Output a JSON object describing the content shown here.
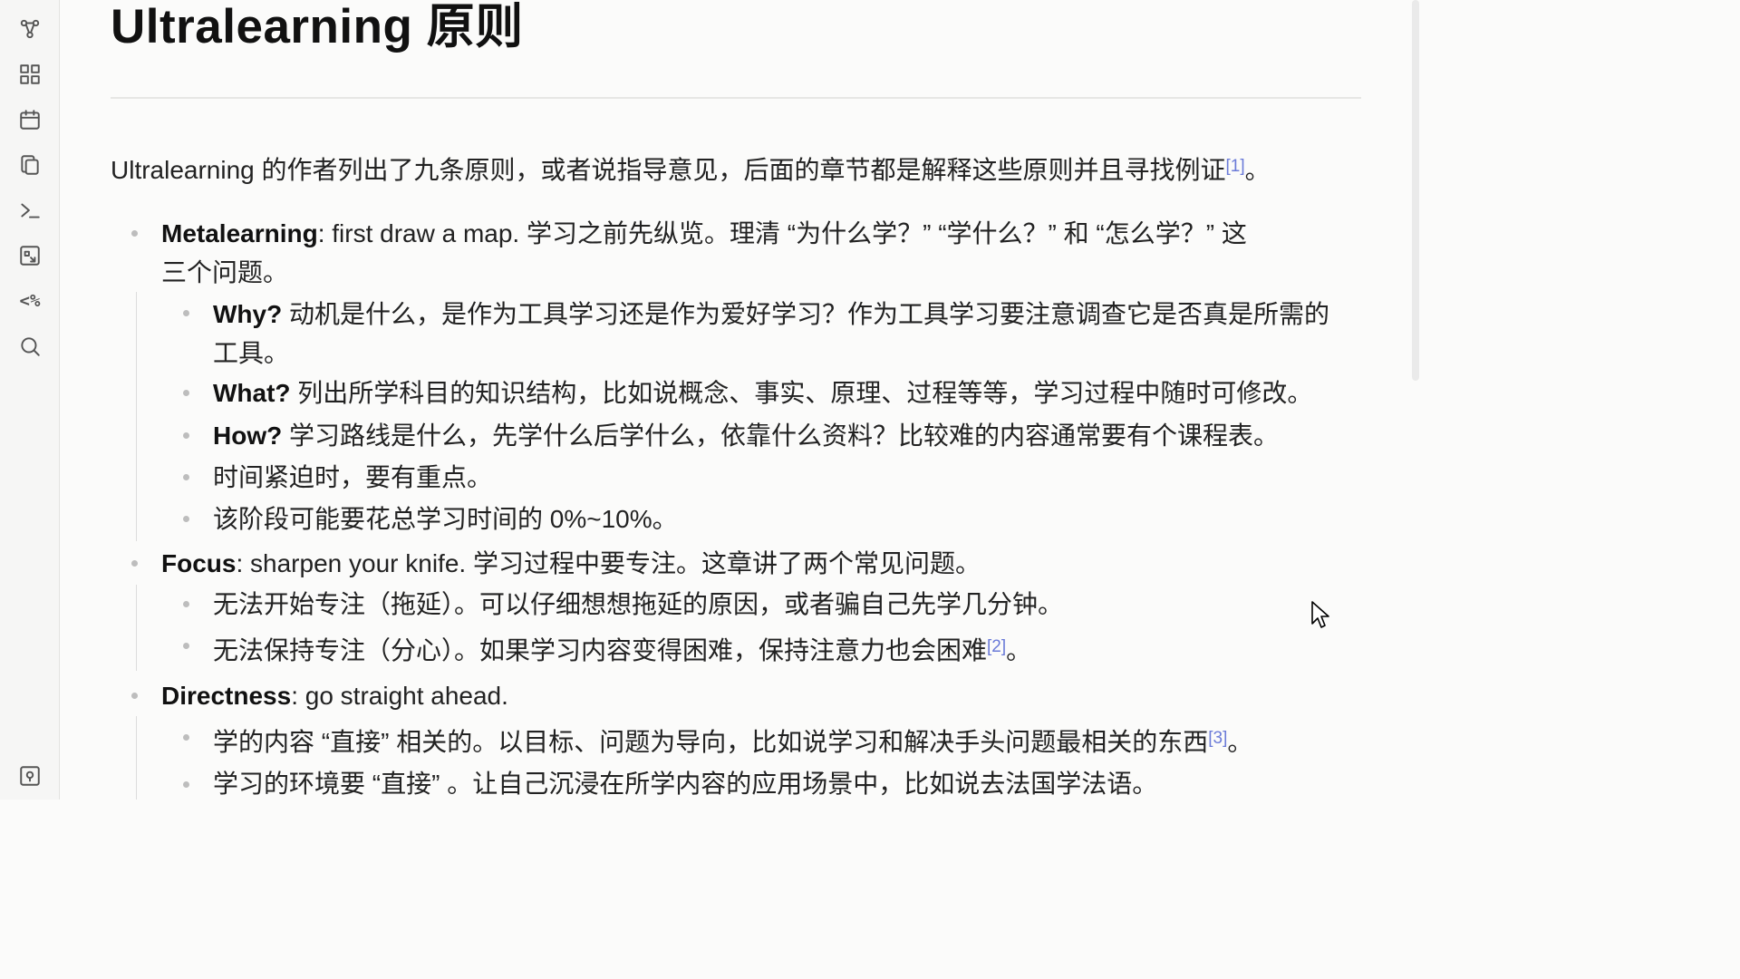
{
  "ribbon": {
    "icons": [
      "graph-view-icon",
      "dashboard-grid-icon",
      "calendar-icon",
      "copy-files-icon",
      "command-palette-icon",
      "canvas-icon",
      "template-icon",
      "search-icon",
      "help-icon"
    ],
    "template_glyph": "<%",
    "terminal_glyph": ">_"
  },
  "page": {
    "title": "Ultralearning 原则",
    "intro": "Ultralearning 的作者列出了九条原则，或者说指导意见，后面的章节都是解释这些原则并且寻找例证",
    "intro_fn": "[1]",
    "intro_end": "。"
  },
  "list": {
    "meta_label": "Metalearning",
    "meta_text_1": ": first draw a map. 学习之前先纵览。理清 “为什么学？” “学什么？” 和 “怎么学？” 这",
    "meta_text_2": "三个问题。",
    "why_label": "Why?",
    "why_text_1": " 动机是什么，是作为工具学习还是作为爱好学习？作为工具学习要注意调查它是否真是所需的",
    "why_text_2": "工具。",
    "what_label": "What?",
    "what_text": " 列出所学科目的知识结构，比如说概念、事实、原理、过程等等，学习过程中随时可修改。",
    "how_label": "How?",
    "how_text": " 学习路线是什么，先学什么后学什么，依靠什么资料？比较难的内容通常要有个课程表。",
    "time_text": "时间紧迫时，要有重点。",
    "stage_text": "该阶段可能要花总学习时间的 0%~10%。",
    "focus_label": "Focus",
    "focus_text": ": sharpen your knife. 学习过程中要专注。这章讲了两个常见问题。",
    "focus_sub1": "无法开始专注（拖延）。可以仔细想想拖延的原因，或者骗自己先学几分钟。",
    "focus_sub2": "无法保持专注（分心）。如果学习内容变得困难，保持注意力也会困难",
    "focus_sub2_fn": "[2]",
    "focus_sub2_end": "。",
    "direct_label": "Directness",
    "direct_text": ": go straight ahead.",
    "direct_sub1": "学的内容 “直接” 相关的。以目标、问题为导向，比如说学习和解决手头问题最相关的东西",
    "direct_sub1_fn": "[3]",
    "direct_sub1_end": "。",
    "direct_sub2": "学习的环境要 “直接” 。让自己沉浸在所学内容的应用场景中，比如说去法国学法语。"
  },
  "colors": {
    "background": "#fbfbfa",
    "sidebar": "#f6f6f5",
    "footnote": "#6b7bd8",
    "bullet": "#bdbdbd"
  }
}
